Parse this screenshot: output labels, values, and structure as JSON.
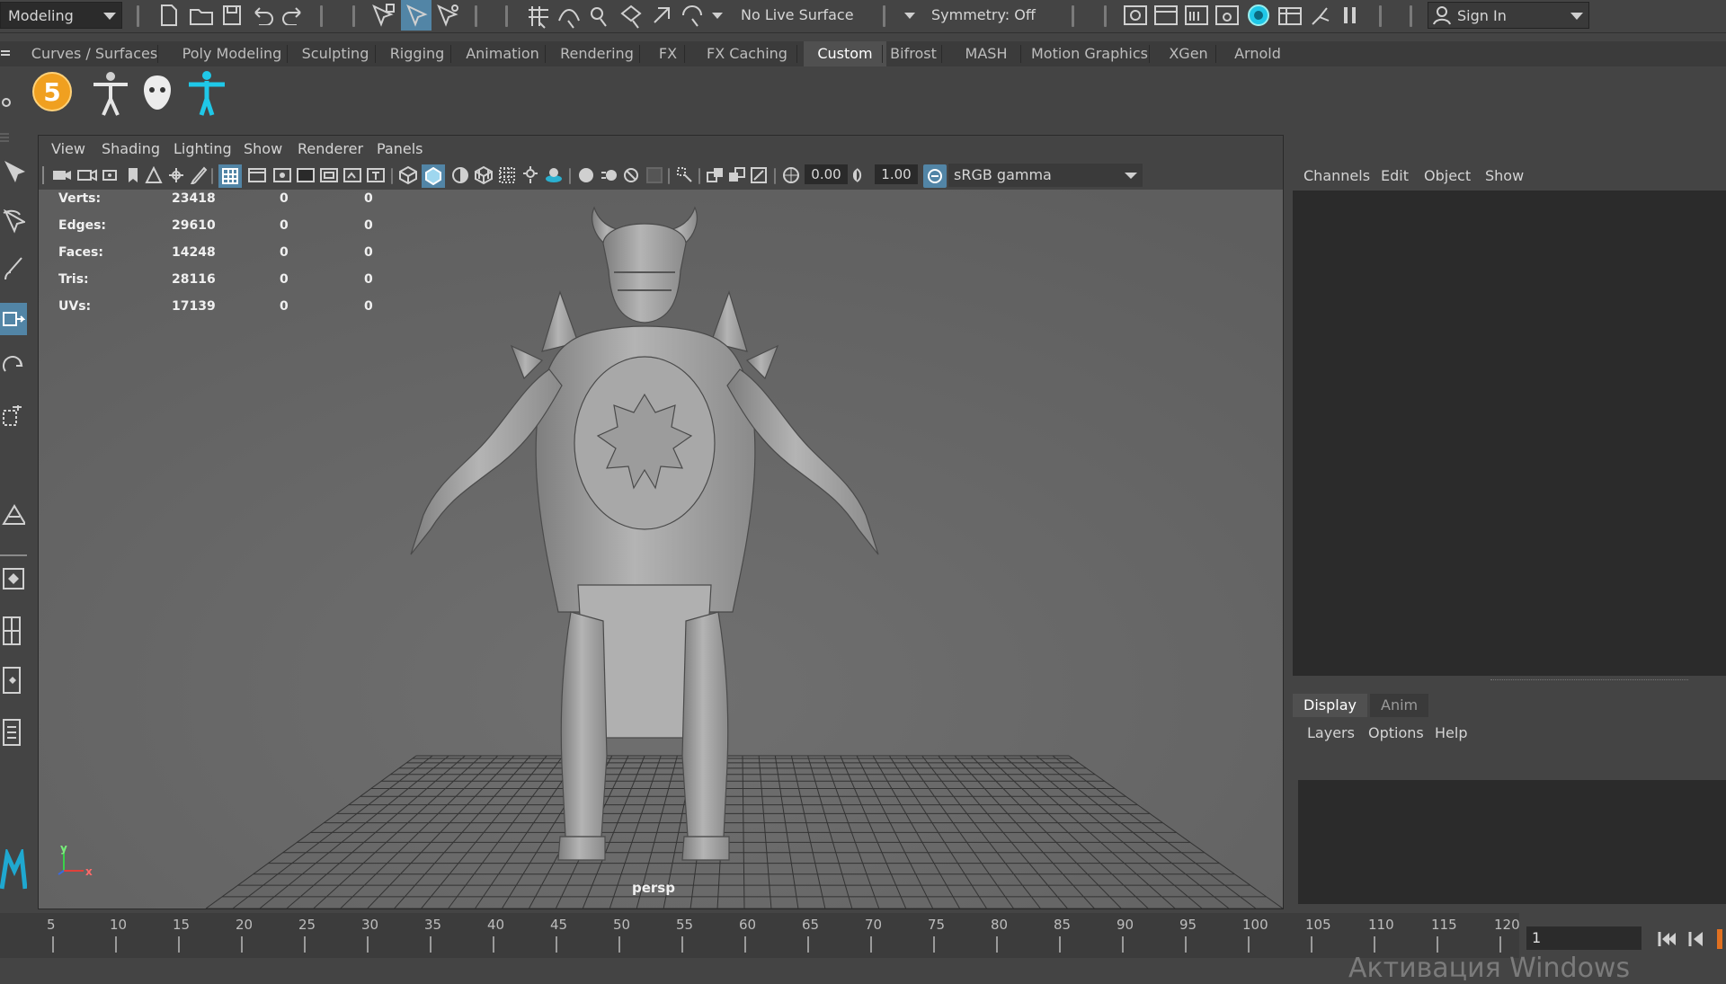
{
  "statusline": {
    "mode_menu": "Modeling",
    "live_surface": "No Live Surface",
    "symmetry": "Symmetry: Off",
    "sign_in": "Sign In"
  },
  "shelf": {
    "tabs": [
      {
        "label": "Curves / Surfaces"
      },
      {
        "label": "Poly Modeling"
      },
      {
        "label": "Sculpting"
      },
      {
        "label": "Rigging"
      },
      {
        "label": "Animation"
      },
      {
        "label": "Rendering"
      },
      {
        "label": "FX"
      },
      {
        "label": "FX Caching"
      },
      {
        "label": "Custom",
        "active": true
      },
      {
        "label": "Bifrost"
      },
      {
        "label": "MASH"
      },
      {
        "label": "Motion Graphics"
      },
      {
        "label": "XGen"
      },
      {
        "label": "Arnold"
      }
    ],
    "badge_number": "5"
  },
  "viewport": {
    "menu": [
      "View",
      "Shading",
      "Lighting",
      "Show",
      "Renderer",
      "Panels"
    ],
    "exposure": "0.00",
    "gamma": "1.00",
    "color_space": "sRGB gamma",
    "camera_label": "persp",
    "axis_y": "y",
    "axis_x": "x",
    "hud_rows": [
      {
        "label": "Verts:",
        "v1": "23418",
        "v2": "0",
        "v3": "0"
      },
      {
        "label": "Edges:",
        "v1": "29610",
        "v2": "0",
        "v3": "0"
      },
      {
        "label": "Faces:",
        "v1": "14248",
        "v2": "0",
        "v3": "0"
      },
      {
        "label": "Tris:",
        "v1": "28116",
        "v2": "0",
        "v3": "0"
      },
      {
        "label": "UVs:",
        "v1": "17139",
        "v2": "0",
        "v3": "0"
      }
    ]
  },
  "channel_box": {
    "menu": [
      "Channels",
      "Edit",
      "Object",
      "Show"
    ]
  },
  "layer_editor": {
    "tabs": [
      "Display",
      "Anim"
    ],
    "menu": [
      "Layers",
      "Options",
      "Help"
    ]
  },
  "timeline": {
    "ticks": [
      "5",
      "10",
      "15",
      "20",
      "25",
      "30",
      "35",
      "40",
      "45",
      "50",
      "55",
      "60",
      "65",
      "70",
      "75",
      "80",
      "85",
      "90",
      "95",
      "100",
      "105",
      "110",
      "115",
      "120"
    ],
    "current_frame": "1",
    "watermark": "Активация Windows"
  },
  "colors": {
    "accent": "#5285a6",
    "cyan_icon": "#1fc8e8",
    "badge": "#f0a020"
  }
}
